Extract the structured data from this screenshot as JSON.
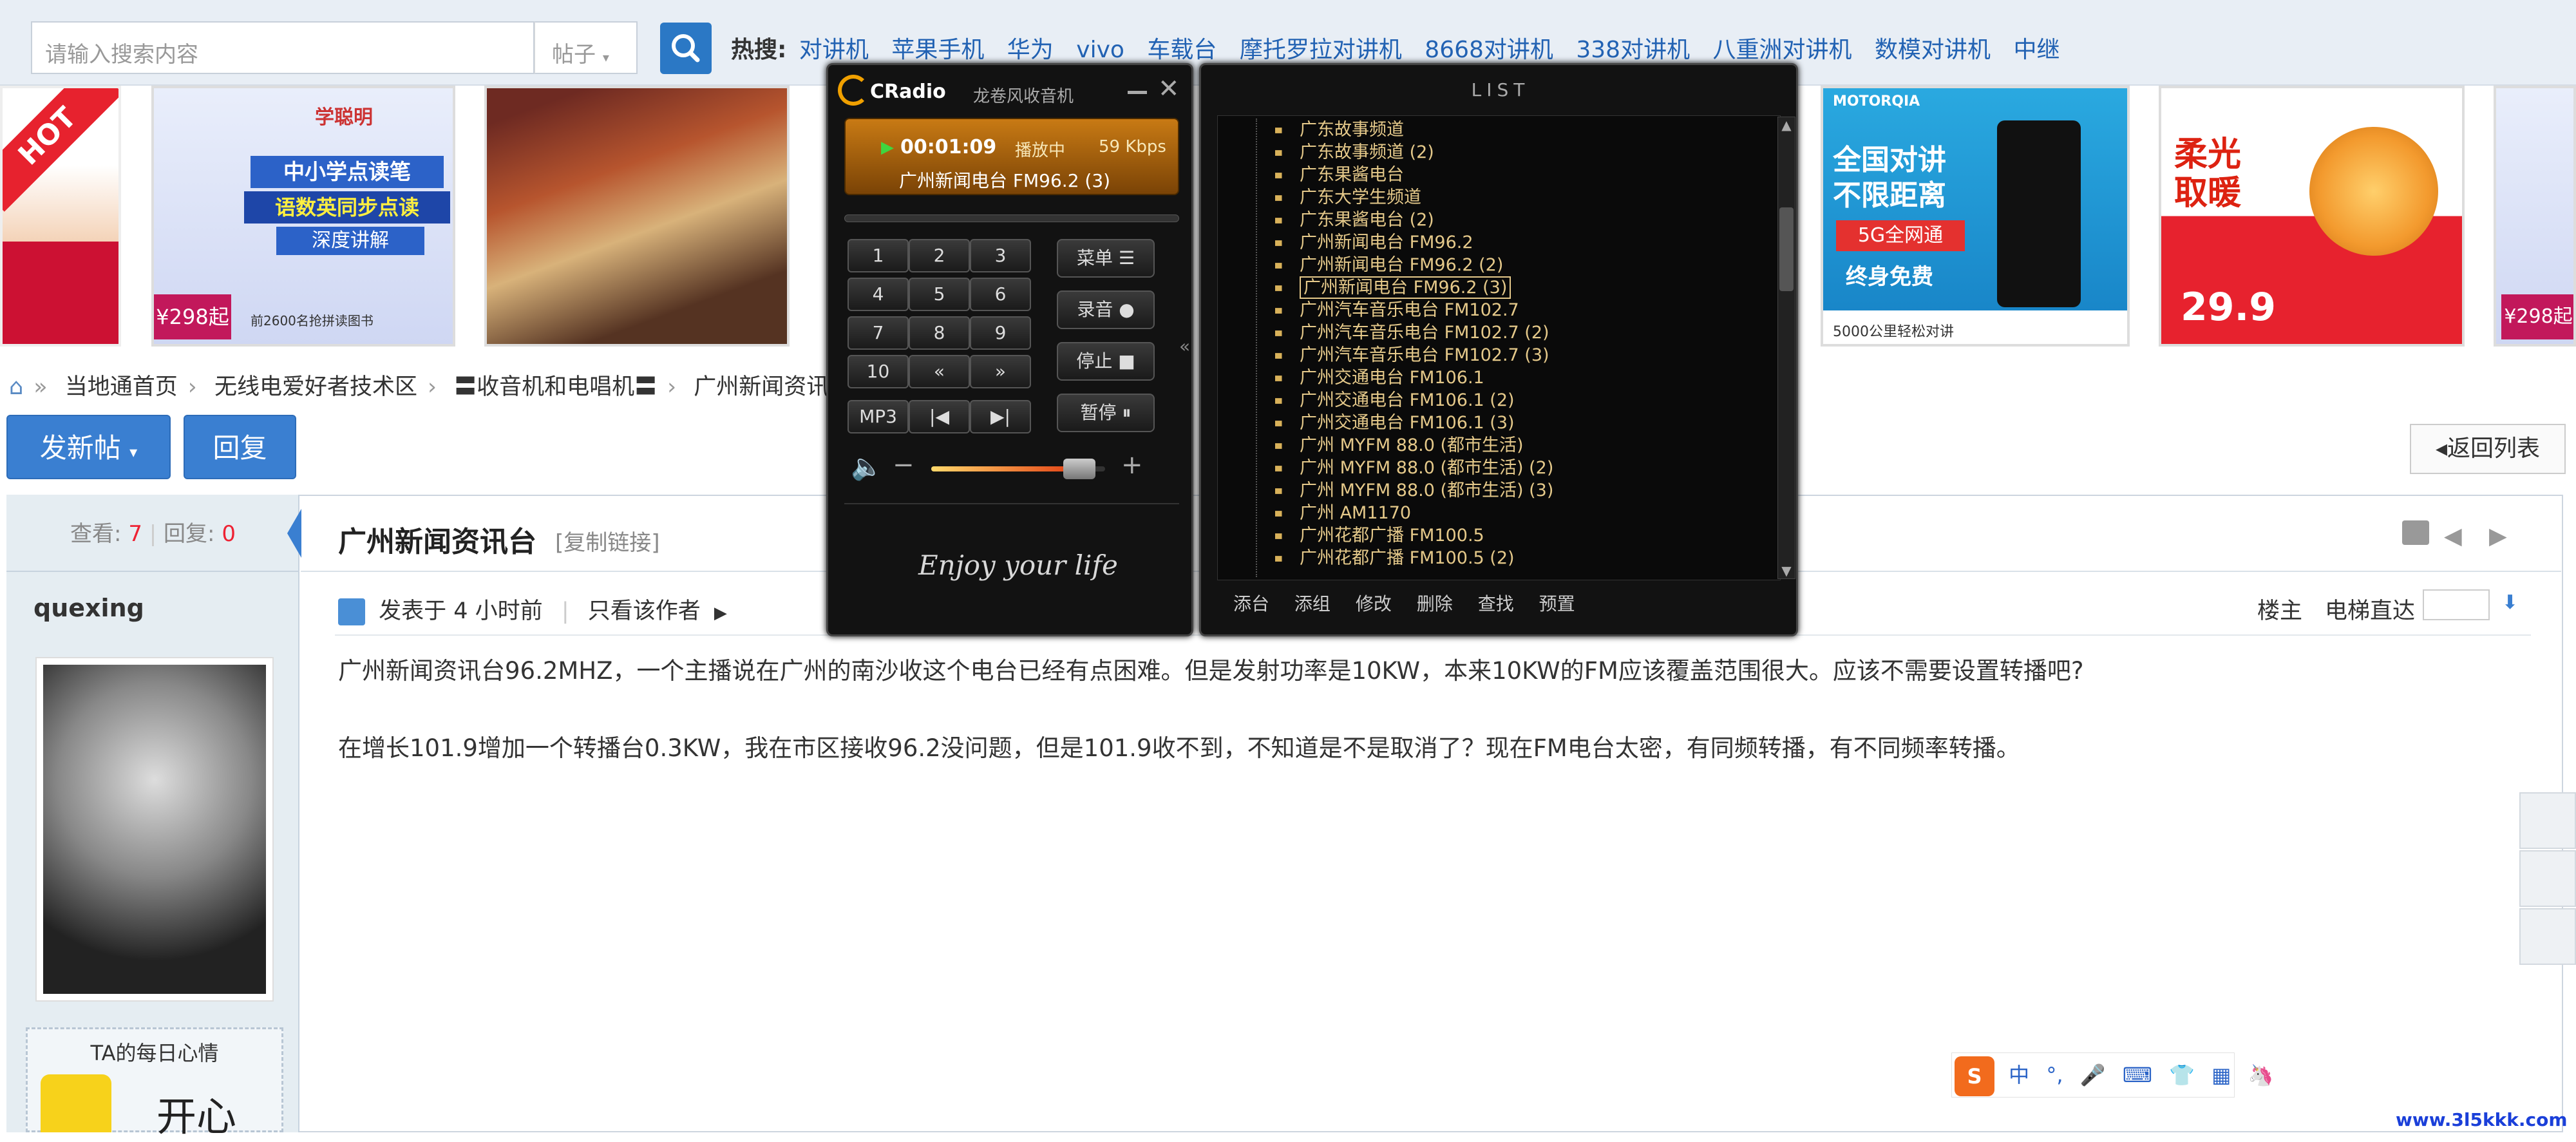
{
  "search": {
    "placeholder": "请输入搜索内容",
    "type_select": "帖子"
  },
  "hot": {
    "label": "热搜:",
    "items": [
      "对讲机",
      "苹果手机",
      "华为",
      "vivo",
      "车载台",
      "摩托罗拉对讲机",
      "8668对讲机",
      "338对讲机",
      "八重洲对讲机",
      "数模对讲机",
      "中继"
    ]
  },
  "ads": [
    {
      "text": "HOT"
    },
    {
      "brand": "学聪明",
      "line1": "中小学点读笔",
      "line2": "语数英同步点读",
      "line3": "深度讲解",
      "price": "¥298起",
      "note": "前2600名抢拼读图书"
    },
    {
      "text": ""
    },
    {
      "brand": "MOTORQIA",
      "line1": "全国对讲",
      "line2": "不限距离",
      "line3": "5G全网通",
      "line4": "终身免费",
      "note": "5000公里轻松对讲"
    },
    {
      "line1": "柔光",
      "line2": "取暖",
      "price": "29.9"
    },
    {
      "price": "¥298起"
    }
  ],
  "breadcrumb": [
    "当地通首页",
    "无线电爱好者技术区",
    "〓收音机和电唱机〓",
    "广州新闻资讯"
  ],
  "actions": {
    "new_post": "发新帖",
    "reply": "回复",
    "return_list": "返回列表"
  },
  "stats": {
    "views_label": "查看:",
    "views": "7",
    "replies_label": "回复:",
    "replies": "0"
  },
  "post": {
    "title": "广州新闻资讯台",
    "copy_link": "[复制链接]",
    "author": "quexing",
    "posted": "发表于 4 小时前",
    "only_author": "只看该作者",
    "floor_owner": "楼主",
    "elevator": "电梯直达",
    "paragraphs": [
      "广州新闻资讯台96.2MHZ，一个主播说在广州的南沙收这个电台已经有点困难。但是发射功率是10KW，本来10KW的FM应该覆盖范围很大。应该不需要设置转播吧?",
      "在增长101.9增加一个转播台0.3KW，我在市区接收96.2没问题，但是101.9收不到，不知道是不是取消了？现在FM电台太密，有同频转播，有不同频率转播。"
    ]
  },
  "mood": {
    "label": "TA的每日心情",
    "value": "开心"
  },
  "player": {
    "app": "CRadio",
    "subtitle": "龙卷风收音机",
    "time": "00:01:09",
    "state": "播放中",
    "bitrate": "59 Kbps",
    "station": "广州新闻电台 FM96.2 (3)",
    "keys": [
      "1",
      "2",
      "3",
      "4",
      "5",
      "6",
      "7",
      "8",
      "9",
      "10",
      "«",
      "»",
      "MP3",
      "|◀",
      "▶|"
    ],
    "func_keys": [
      "菜单",
      "录音",
      "停止",
      "暂停"
    ],
    "slogan": "Enjoy your life",
    "volume": 0.85
  },
  "list": {
    "header": "LIST",
    "items": [
      "广东故事频道",
      "广东故事频道 (2)",
      "广东果酱电台",
      "广东大学生频道",
      "广东果酱电台 (2)",
      "广州新闻电台 FM96.2",
      "广州新闻电台 FM96.2 (2)",
      "广州新闻电台 FM96.2 (3)",
      "广州汽车音乐电台 FM102.7",
      "广州汽车音乐电台 FM102.7 (2)",
      "广州汽车音乐电台 FM102.7 (3)",
      "广州交通电台 FM106.1",
      "广州交通电台 FM106.1 (2)",
      "广州交通电台 FM106.1 (3)",
      "广州 MYFM 88.0 (都市生活)",
      "广州 MYFM 88.0 (都市生活) (2)",
      "广州 MYFM 88.0 (都市生活) (3)",
      "广州 AM1170",
      "广州花都广播 FM100.5",
      "广州花都广播 FM100.5 (2)"
    ],
    "selected_index": 7,
    "footer": [
      "添台",
      "添组",
      "修改",
      "删除",
      "查找",
      "预置"
    ]
  },
  "ime": {
    "items": [
      "中",
      "°,",
      "🎤",
      "⌨",
      "👕",
      "▦",
      "🦄"
    ]
  },
  "watermark": "www.3l5kkk.com"
}
